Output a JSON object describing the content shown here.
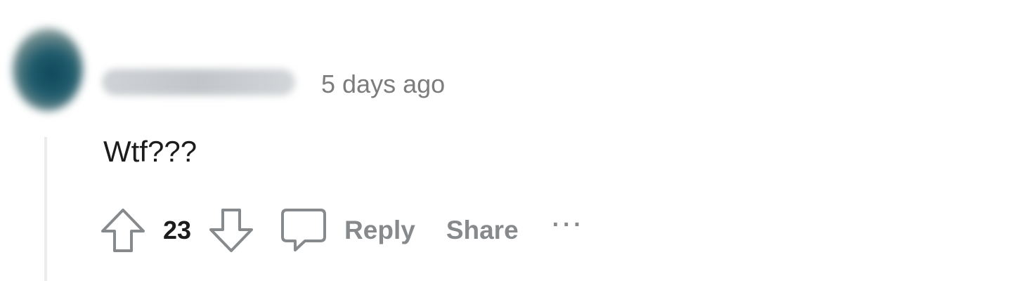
{
  "comment": {
    "username": "",
    "timestamp": "5 days ago",
    "body": "Wtf???",
    "score": "23"
  },
  "actions": {
    "reply_label": "Reply",
    "share_label": "Share",
    "more_label": "···"
  },
  "icons": {
    "upvote": "arrow-up-icon",
    "downvote": "arrow-down-icon",
    "reply": "speech-bubble-icon"
  },
  "colors": {
    "text_primary": "#1c1c1c",
    "text_muted": "#878a8c",
    "thread_line": "#ececec"
  }
}
